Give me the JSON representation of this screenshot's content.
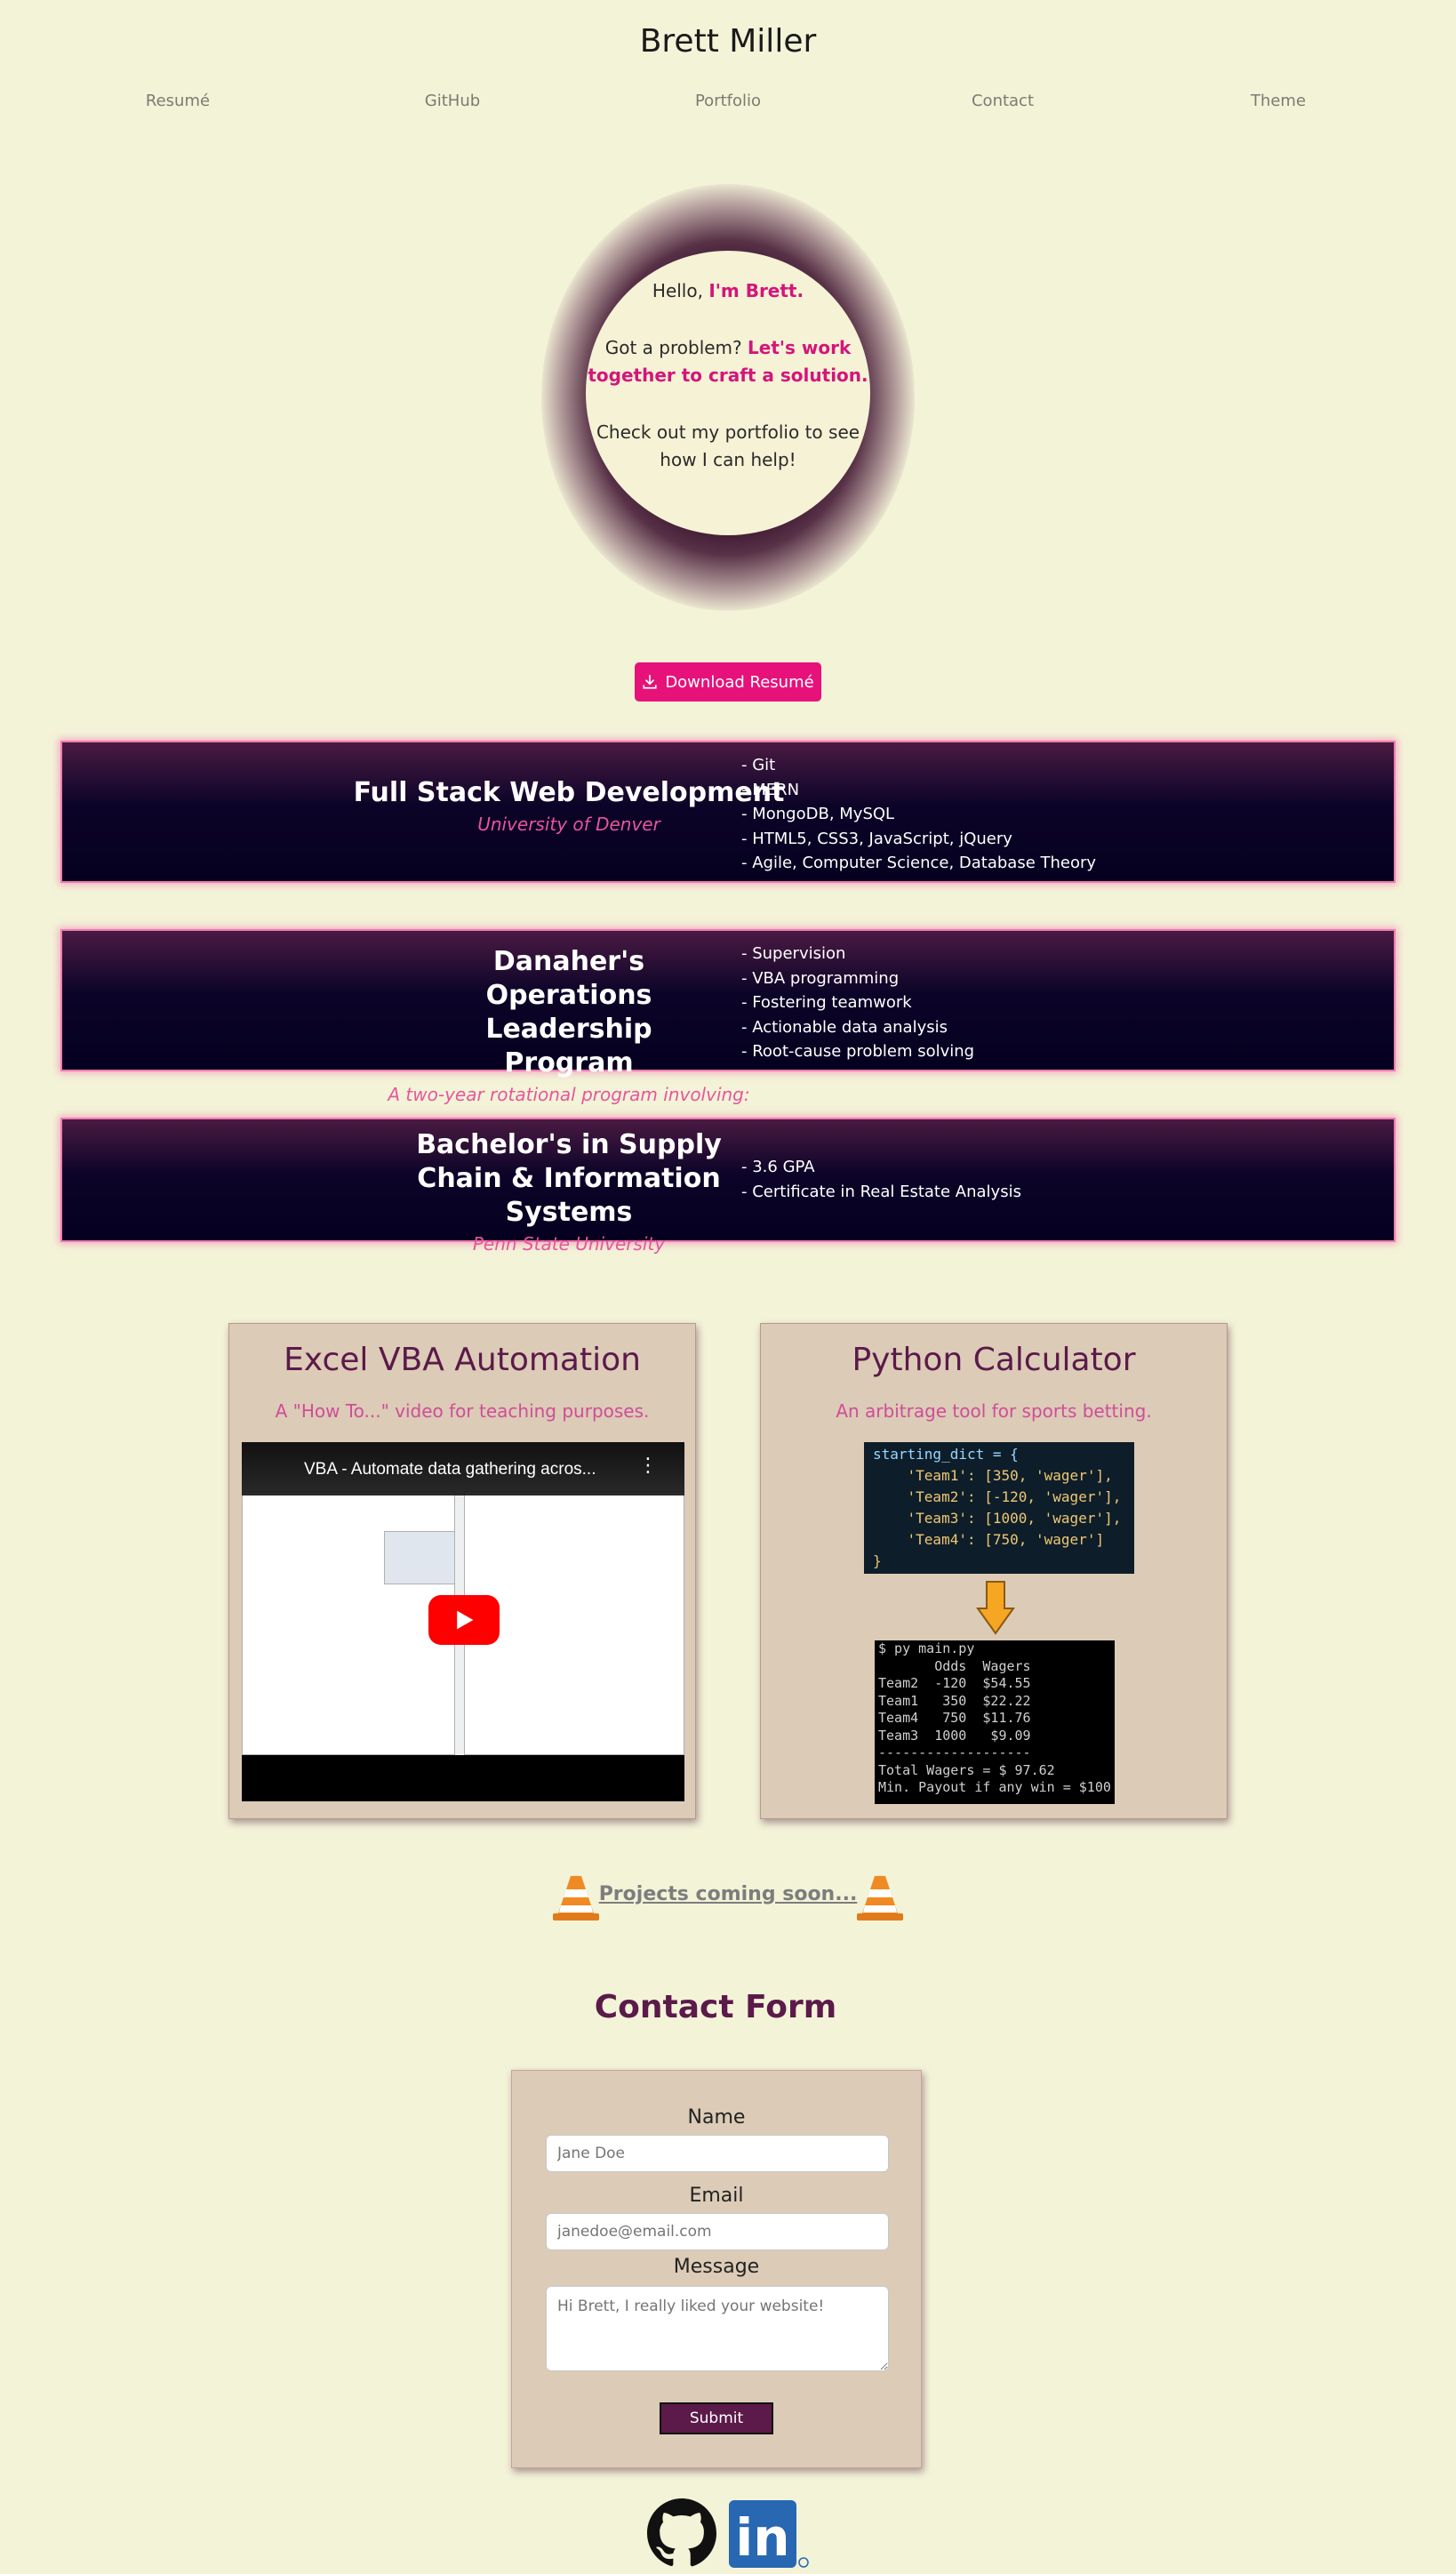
{
  "header": {
    "title": "Brett Miller",
    "nav": [
      "Resumé",
      "GitHub",
      "Portfolio",
      "Contact",
      "Theme"
    ]
  },
  "hero": {
    "line1_plain": "Hello, ",
    "line1_emph": "I'm Brett.",
    "line2_plain": "Got a problem? ",
    "line2_emph": "Let's work together to craft a solution.",
    "line3": "Check out my portfolio to see how I can help!"
  },
  "download_button": "Download Resumé",
  "experience": [
    {
      "title": "Full Stack Web Development",
      "subtitle": "University of Denver",
      "items": [
        "- Git",
        "- MERN",
        "- MongoDB, MySQL",
        "- HTML5, CSS3, JavaScript, jQuery",
        "- Agile, Computer Science, Database Theory"
      ]
    },
    {
      "title": "Danaher's Operations Leadership Program",
      "subtitle": "A two-year rotational program involving:",
      "items": [
        "- Supervision",
        "- VBA programming",
        "- Fostering teamwork",
        "- Actionable data analysis",
        "- Root-cause problem solving"
      ]
    },
    {
      "title": "Bachelor's in Supply Chain & Information Systems",
      "subtitle": "Penn State University",
      "items": [
        "- 3.6 GPA",
        "- Certificate in Real Estate Analysis"
      ]
    }
  ],
  "projects": {
    "vba": {
      "title": "Excel VBA Automation",
      "subtitle": "A \"How To...\" video for teaching purposes.",
      "video_title": "VBA - Automate data gathering acros..."
    },
    "python": {
      "title": "Python Calculator",
      "subtitle": "An arbitrage tool for sports betting.",
      "code_lines": [
        "starting_dict = {",
        "    'Team1': [350, 'wager'],",
        "    'Team2': [-120, 'wager'],",
        "    'Team3': [1000, 'wager'],",
        "    'Team4': [750, 'wager']",
        "}"
      ],
      "terminal_lines": [
        "$ py main.py",
        "       Odds  Wagers",
        "Team2  -120  $54.55",
        "Team1   350  $22.22",
        "Team4   750  $11.76",
        "Team3  1000   $9.09",
        "-------------------",
        "Total Wagers = $ 97.62",
        "Min. Payout if any win = $100"
      ]
    }
  },
  "coming_soon": "Projects coming soon...",
  "contact": {
    "heading": "Contact Form",
    "name_label": "Name",
    "name_placeholder": "Jane Doe",
    "email_label": "Email",
    "email_placeholder": "janedoe@email.com",
    "message_label": "Message",
    "message_placeholder": "Hi Brett, I really liked your website!",
    "submit_label": "Submit"
  },
  "social": {
    "github_icon": "github-icon",
    "linkedin_icon": "linkedin-icon",
    "linkedin_text": "in"
  },
  "colors": {
    "background": "#f3f3d8",
    "accent_pink": "#e6127a",
    "plum": "#5b1a4a",
    "card": "#dccbb6"
  }
}
